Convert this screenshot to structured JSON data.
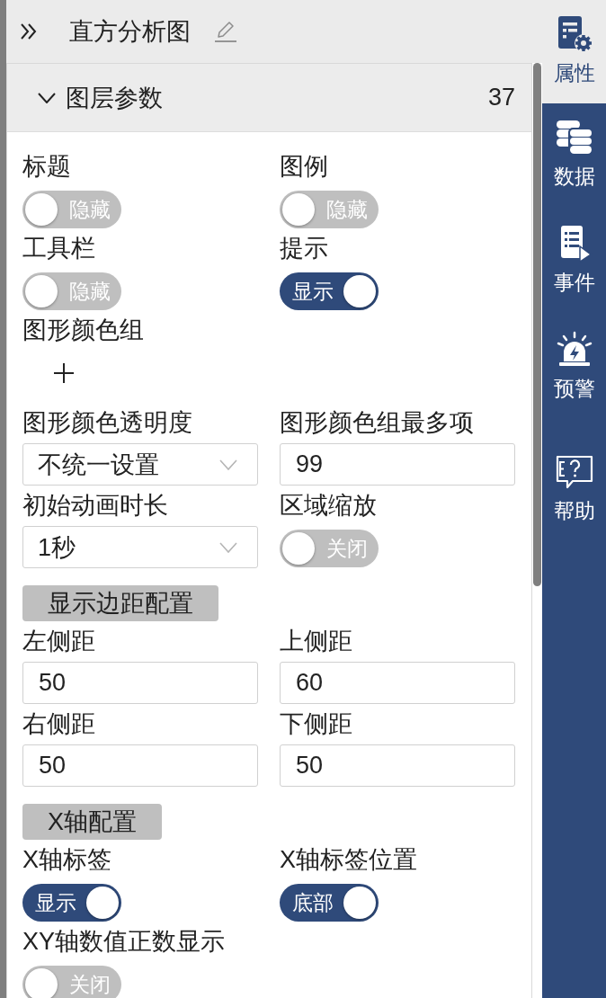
{
  "header": {
    "title": "直方分析图"
  },
  "section": {
    "title": "图层参数",
    "count": "37",
    "expanded": true
  },
  "fields": [
    {
      "kind": "toggle",
      "label": "标题",
      "on": false,
      "text": "隐藏"
    },
    {
      "kind": "toggle",
      "label": "图例",
      "on": false,
      "text": "隐藏"
    },
    {
      "kind": "toggle",
      "label": "工具栏",
      "on": false,
      "text": "隐藏"
    },
    {
      "kind": "toggle",
      "label": "提示",
      "on": true,
      "text": "显示"
    },
    {
      "kind": "color_group",
      "label": "图形颜色组"
    },
    {
      "kind": "select",
      "label": "图形颜色透明度",
      "value": "不统一设置"
    },
    {
      "kind": "input",
      "label": "图形颜色组最多项",
      "value": "99"
    },
    {
      "kind": "select",
      "label": "初始动画时长",
      "value": "1秒"
    },
    {
      "kind": "toggle",
      "label": "区域缩放",
      "on": false,
      "text": "关闭"
    },
    {
      "kind": "group_button",
      "label": "显示边距配置"
    },
    {
      "kind": "input",
      "label": "左侧距",
      "value": "50"
    },
    {
      "kind": "input",
      "label": "上侧距",
      "value": "60"
    },
    {
      "kind": "input",
      "label": "右侧距",
      "value": "50"
    },
    {
      "kind": "input",
      "label": "下侧距",
      "value": "50"
    },
    {
      "kind": "group_button",
      "label": "X轴配置"
    },
    {
      "kind": "toggle",
      "label": "X轴标签",
      "on": true,
      "text": "显示"
    },
    {
      "kind": "toggle",
      "label": "X轴标签位置",
      "on": true,
      "text": "底部"
    },
    {
      "kind": "toggle",
      "label": "XY轴数值正数显示",
      "on": false,
      "text": "关闭"
    }
  ],
  "sidebar": {
    "items": [
      {
        "kind": "properties",
        "label": "属性",
        "selected": true
      },
      {
        "kind": "data",
        "label": "数据",
        "selected": false
      },
      {
        "kind": "events",
        "label": "事件",
        "selected": false
      },
      {
        "kind": "alerts",
        "label": "预警",
        "selected": false
      },
      {
        "kind": "help",
        "label": "帮助",
        "selected": false
      }
    ]
  }
}
